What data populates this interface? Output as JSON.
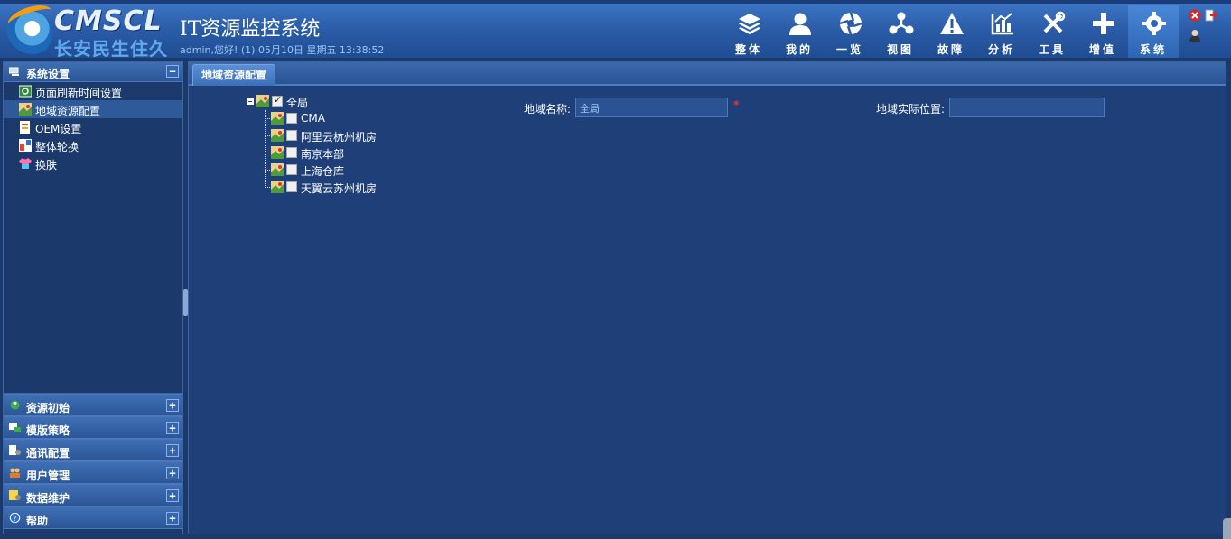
{
  "header": {
    "brand": "CMSCL",
    "brand_cn": "长安民生住久",
    "title": "IT资源监控系统",
    "greeting": "admin,您好! (1) 05月10日 星期五 13:38:52"
  },
  "nav": [
    {
      "label": "整体",
      "icon": "layers-icon"
    },
    {
      "label": "我的",
      "icon": "user-icon"
    },
    {
      "label": "一览",
      "icon": "aperture-icon"
    },
    {
      "label": "视图",
      "icon": "network-icon"
    },
    {
      "label": "故障",
      "icon": "warning-icon"
    },
    {
      "label": "分析",
      "icon": "chart-icon"
    },
    {
      "label": "工具",
      "icon": "tools-icon"
    },
    {
      "label": "增值",
      "icon": "plus-icon"
    },
    {
      "label": "系统",
      "icon": "gear-icon",
      "active": true
    }
  ],
  "sidebar": {
    "open_panel": "系统设置",
    "items": [
      {
        "label": "页面刷新时间设置"
      },
      {
        "label": "地域资源配置",
        "selected": true
      },
      {
        "label": "OEM设置"
      },
      {
        "label": "整体轮换"
      },
      {
        "label": "换肤"
      }
    ],
    "collapsed": [
      {
        "label": "资源初始"
      },
      {
        "label": "模版策略"
      },
      {
        "label": "通讯配置"
      },
      {
        "label": "用户管理"
      },
      {
        "label": "数据维护"
      },
      {
        "label": "帮助"
      }
    ]
  },
  "main": {
    "tab": "地域资源配置",
    "tree": {
      "root": "全局",
      "children": [
        "CMA",
        "阿里云杭州机房",
        "南京本部",
        "上海仓库",
        "天翼云苏州机房"
      ]
    },
    "form": {
      "region_name_label": "地域名称:",
      "region_name_value": "全局",
      "location_label": "地域实际位置:",
      "location_value": ""
    }
  },
  "colors": {
    "background": "#1b3a6b",
    "header": "#2a5ba6",
    "required": "#ee3333"
  }
}
